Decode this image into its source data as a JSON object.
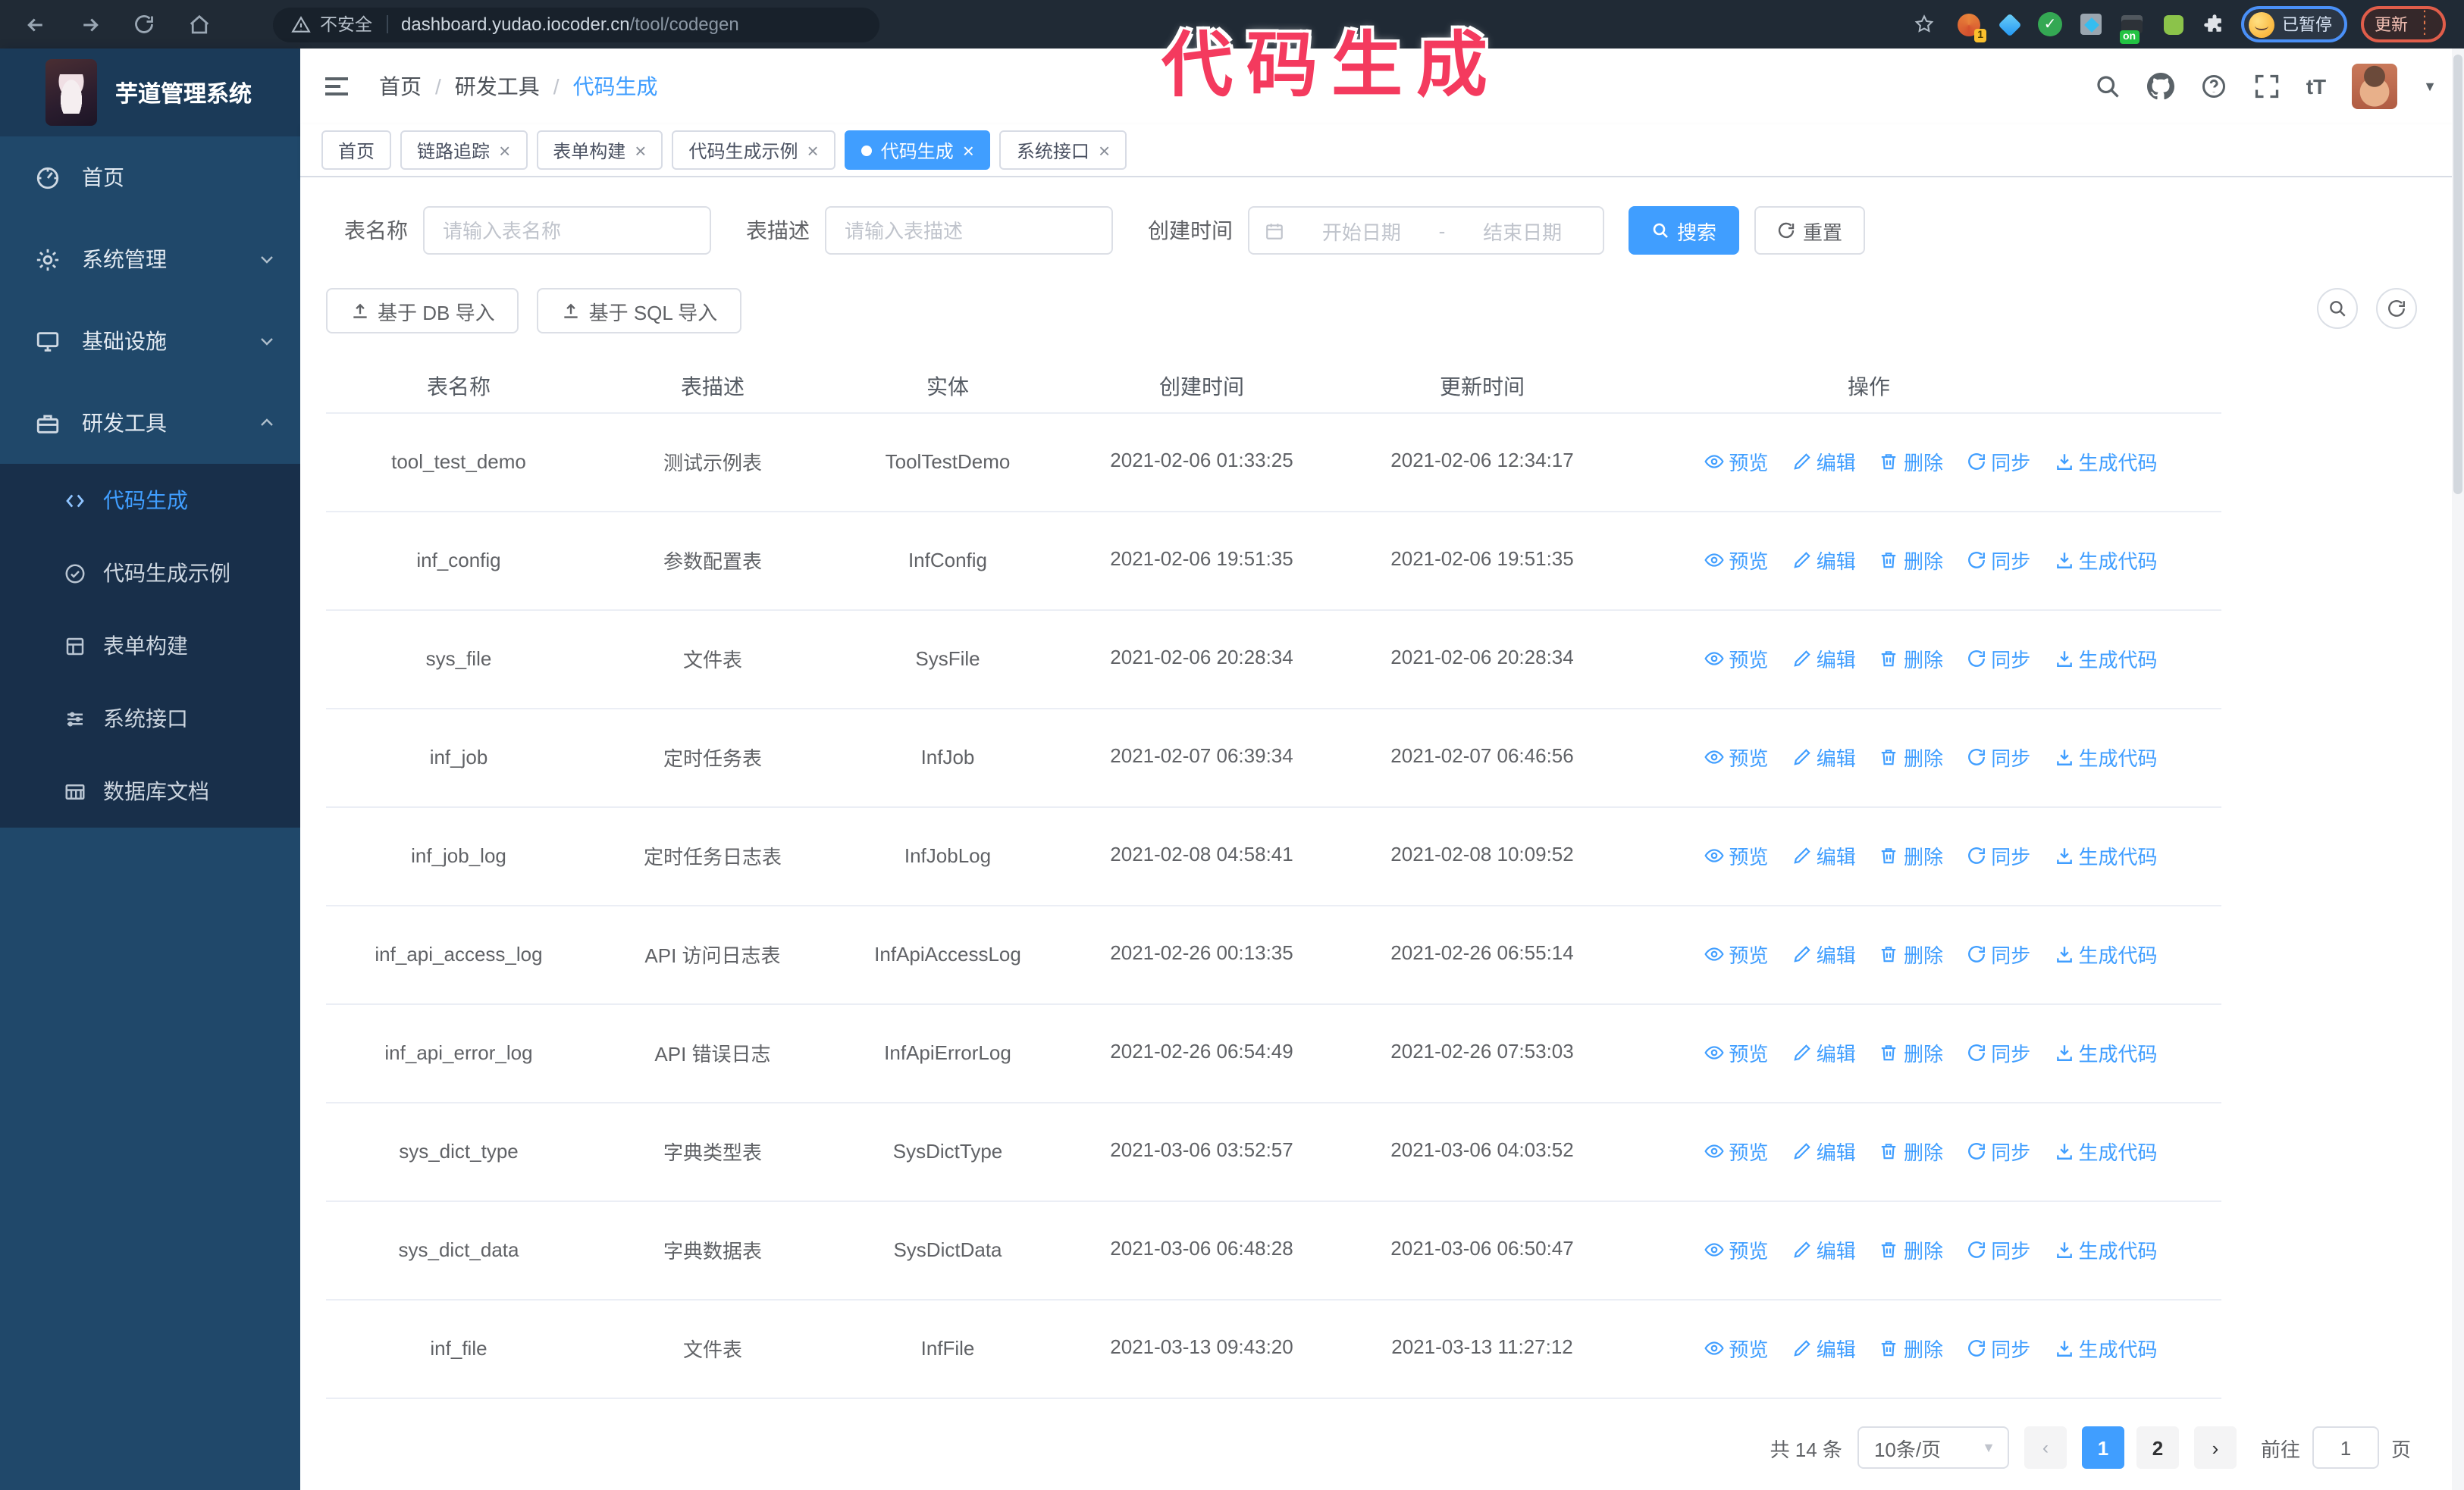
{
  "browser": {
    "security_label": "不安全",
    "url_host": "dashboard.yudao.iocoder.cn",
    "url_path": "/tool/codegen",
    "extension_badge": "1",
    "extension_on_badge": "on",
    "paused_badge": "已暂停",
    "update_button": "更新"
  },
  "annotation": {
    "text": "代码生成",
    "color": "#f43a5e"
  },
  "sidebar": {
    "logo_title": "芋道管理系统",
    "menu": [
      {
        "label": "首页",
        "icon": "dashboard-icon"
      },
      {
        "label": "系统管理",
        "icon": "gear-icon"
      },
      {
        "label": "基础设施",
        "icon": "infrastructure-icon"
      },
      {
        "label": "研发工具",
        "icon": "tools-icon"
      }
    ],
    "submenu": [
      {
        "label": "代码生成",
        "icon": "code-icon",
        "active": true
      },
      {
        "label": "代码生成示例",
        "icon": "example-icon",
        "active": false
      },
      {
        "label": "表单构建",
        "icon": "form-builder-icon",
        "active": false
      },
      {
        "label": "系统接口",
        "icon": "api-icon",
        "active": false
      },
      {
        "label": "数据库文档",
        "icon": "database-doc-icon",
        "active": false
      }
    ]
  },
  "header": {
    "breadcrumb": [
      "首页",
      "研发工具",
      "代码生成"
    ]
  },
  "tabs": [
    {
      "label": "首页",
      "closable": false,
      "active": false
    },
    {
      "label": "链路追踪",
      "closable": true,
      "active": false
    },
    {
      "label": "表单构建",
      "closable": true,
      "active": false
    },
    {
      "label": "代码生成示例",
      "closable": true,
      "active": false
    },
    {
      "label": "代码生成",
      "closable": true,
      "active": true
    },
    {
      "label": "系统接口",
      "closable": true,
      "active": false
    }
  ],
  "filters": {
    "table_name": {
      "label": "表名称",
      "placeholder": "请输入表名称",
      "value": ""
    },
    "table_desc": {
      "label": "表描述",
      "placeholder": "请输入表描述",
      "value": ""
    },
    "create_time": {
      "label": "创建时间",
      "start_placeholder": "开始日期",
      "separator": "-",
      "end_placeholder": "结束日期"
    },
    "search_button": "搜索",
    "reset_button": "重置"
  },
  "toolbar": {
    "import_db_button": "基于 DB 导入",
    "import_sql_button": "基于 SQL 导入"
  },
  "table": {
    "columns": [
      "表名称",
      "表描述",
      "实体",
      "创建时间",
      "更新时间",
      "操作"
    ],
    "action_labels": [
      "预览",
      "编辑",
      "删除",
      "同步",
      "生成代码"
    ],
    "rows": [
      {
        "name": "tool_test_demo",
        "description": "测试示例表",
        "entity": "ToolTestDemo",
        "create_time": "2021-02-06 01:33:25",
        "update_time": "2021-02-06 12:34:17"
      },
      {
        "name": "inf_config",
        "description": "参数配置表",
        "entity": "InfConfig",
        "create_time": "2021-02-06 19:51:35",
        "update_time": "2021-02-06 19:51:35"
      },
      {
        "name": "sys_file",
        "description": "文件表",
        "entity": "SysFile",
        "create_time": "2021-02-06 20:28:34",
        "update_time": "2021-02-06 20:28:34"
      },
      {
        "name": "inf_job",
        "description": "定时任务表",
        "entity": "InfJob",
        "create_time": "2021-02-07 06:39:34",
        "update_time": "2021-02-07 06:46:56"
      },
      {
        "name": "inf_job_log",
        "description": "定时任务日志表",
        "entity": "InfJobLog",
        "create_time": "2021-02-08 04:58:41",
        "update_time": "2021-02-08 10:09:52"
      },
      {
        "name": "inf_api_access_log",
        "description": "API 访问日志表",
        "entity": "InfApiAccessLog",
        "create_time": "2021-02-26 00:13:35",
        "update_time": "2021-02-26 06:55:14"
      },
      {
        "name": "inf_api_error_log",
        "description": "API 错误日志",
        "entity": "InfApiErrorLog",
        "create_time": "2021-02-26 06:54:49",
        "update_time": "2021-02-26 07:53:03"
      },
      {
        "name": "sys_dict_type",
        "description": "字典类型表",
        "entity": "SysDictType",
        "create_time": "2021-03-06 03:52:57",
        "update_time": "2021-03-06 04:03:52"
      },
      {
        "name": "sys_dict_data",
        "description": "字典数据表",
        "entity": "SysDictData",
        "create_time": "2021-03-06 06:48:28",
        "update_time": "2021-03-06 06:50:47"
      },
      {
        "name": "inf_file",
        "description": "文件表",
        "entity": "InfFile",
        "create_time": "2021-03-13 09:43:20",
        "update_time": "2021-03-13 11:27:12"
      }
    ]
  },
  "pagination": {
    "total": "共 14 条",
    "page_size": "10条/页",
    "pages": [
      "1",
      "2"
    ],
    "active_page": "1",
    "goto_label": "前往",
    "goto_value": "1",
    "goto_suffix": "页"
  },
  "colors": {
    "accent": "#409eff",
    "sidebar_bg": "#20486a",
    "submenu_bg": "#182f4a",
    "annotation": "#f43a5e"
  }
}
